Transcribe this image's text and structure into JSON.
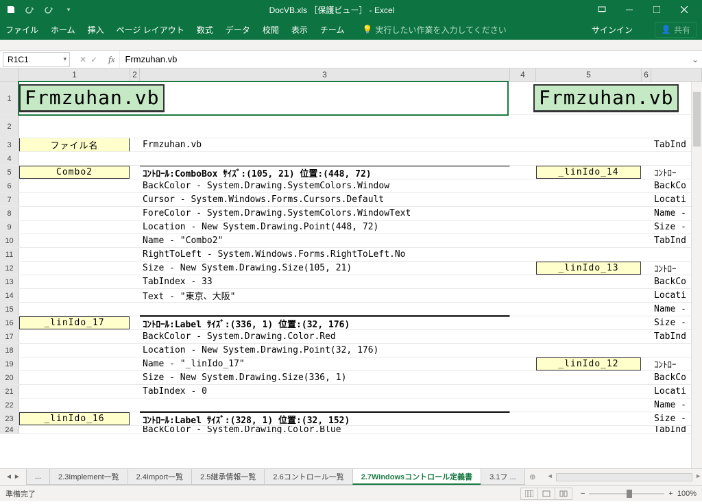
{
  "window": {
    "title": "DocVB.xls ［保護ビュー］ - Excel"
  },
  "ribbon": {
    "tabs": [
      "ファイル",
      "ホーム",
      "挿入",
      "ページ レイアウト",
      "数式",
      "データ",
      "校閲",
      "表示",
      "チーム"
    ],
    "tellme": "実行したい作業を入力してください",
    "signin": "サインイン",
    "share": "共有"
  },
  "formula": {
    "namebox": "R1C1",
    "value": "Frmzuhan.vb"
  },
  "columns": [
    "1",
    "2",
    "3",
    "4",
    "5",
    "6"
  ],
  "banner_a": "Frmzuhan.vb",
  "banner_b": "Frmzuhan.vb",
  "rows": [
    {
      "n": "1"
    },
    {
      "n": "2"
    },
    {
      "n": "3",
      "label": "ファイル名",
      "c3": "Frmzuhan.vb",
      "c7": "TabInd"
    },
    {
      "n": "4"
    },
    {
      "n": "5",
      "label": "Combo2",
      "c3": "ｺﾝﾄﾛｰﾙ:ComboBox ｻｲｽﾞ:(105, 21) 位置:(448, 72)",
      "c3b": true,
      "label5": "_linIdo_14",
      "c7": "ｺﾝﾄﾛｰ"
    },
    {
      "n": "6",
      "c3": "BackColor - System.Drawing.SystemColors.Window",
      "c7": "BackCo"
    },
    {
      "n": "7",
      "c3": "Cursor - System.Windows.Forms.Cursors.Default",
      "c7": "Locati"
    },
    {
      "n": "8",
      "c3": "ForeColor - System.Drawing.SystemColors.WindowText",
      "c7": "Name -"
    },
    {
      "n": "9",
      "c3": "Location - New System.Drawing.Point(448, 72)",
      "c7": "Size -"
    },
    {
      "n": "10",
      "c3": "Name - \"Combo2\"",
      "c7": "TabInd"
    },
    {
      "n": "11",
      "c3": "RightToLeft - System.Windows.Forms.RightToLeft.No"
    },
    {
      "n": "12",
      "c3": "Size - New System.Drawing.Size(105, 21)",
      "label5": "_linIdo_13",
      "c7": "ｺﾝﾄﾛｰ"
    },
    {
      "n": "13",
      "c3": "TabIndex - 33",
      "c7": "BackCo"
    },
    {
      "n": "14",
      "c3": "Text - \"東京、大阪\"",
      "c7": "Locati"
    },
    {
      "n": "15",
      "c3": "",
      "under": true,
      "c7": "Name -"
    },
    {
      "n": "16",
      "label": "_linIdo_17",
      "c3": "ｺﾝﾄﾛｰﾙ:Label ｻｲｽﾞ:(336, 1) 位置:(32, 176)",
      "c3b": true,
      "c7": "Size -"
    },
    {
      "n": "17",
      "c3": "BackColor - System.Drawing.Color.Red",
      "c7": "TabInd"
    },
    {
      "n": "18",
      "c3": "Location - New System.Drawing.Point(32, 176)"
    },
    {
      "n": "19",
      "c3": "Name - \"_linIdo_17\"",
      "label5": "_linIdo_12",
      "c7": "ｺﾝﾄﾛｰ"
    },
    {
      "n": "20",
      "c3": "Size - New System.Drawing.Size(336, 1)",
      "c7": "BackCo"
    },
    {
      "n": "21",
      "c3": "TabIndex - 0",
      "c7": "Locati"
    },
    {
      "n": "22",
      "c3": "",
      "under": true,
      "c7": "Name -"
    },
    {
      "n": "23",
      "label": "_linIdo_16",
      "c3": "ｺﾝﾄﾛｰﾙ:Label ｻｲｽﾞ:(328, 1) 位置:(32, 152)",
      "c3b": true,
      "c7": "Size -"
    },
    {
      "n": "24",
      "c3": "BackColor - System.Drawing.Color.Blue",
      "half": true,
      "c7": "TabInd"
    }
  ],
  "sheets": {
    "ellipsis": "...",
    "tabs": [
      "2.3Implement一覧",
      "2.4Import一覧",
      "2.5継承情報一覧",
      "2.6コントロール一覧",
      "2.7Windowsコントロール定義書",
      "3.1フ ..."
    ],
    "active": 4,
    "add": "⊕"
  },
  "status": {
    "ready": "準備完了",
    "zoom": "100%"
  }
}
